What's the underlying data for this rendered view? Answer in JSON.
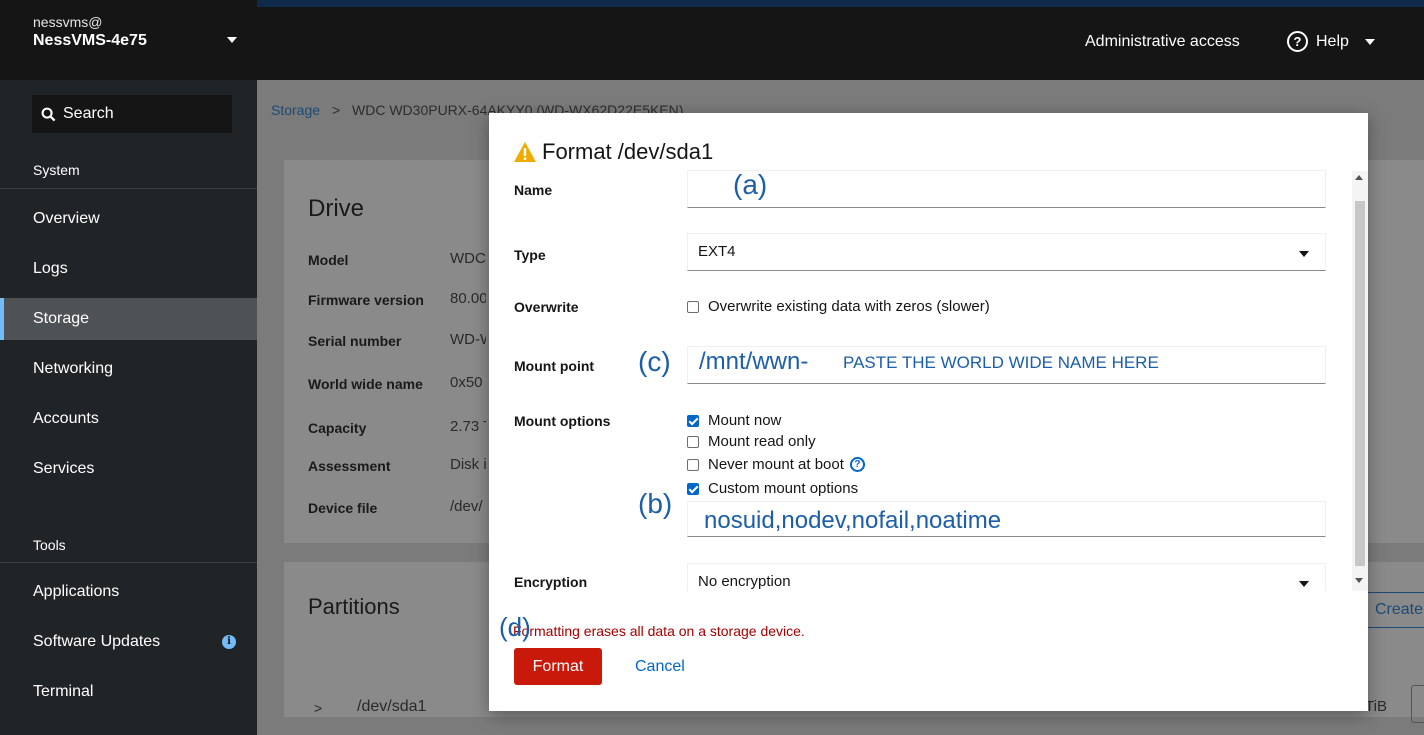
{
  "sidebar": {
    "user": "nessvms@",
    "host": "NessVMS-4e75",
    "search_label": "Search",
    "section_system": "System",
    "section_tools": "Tools",
    "items": [
      {
        "label": "Overview"
      },
      {
        "label": "Logs"
      },
      {
        "label": "Storage"
      },
      {
        "label": "Networking"
      },
      {
        "label": "Accounts"
      },
      {
        "label": "Services"
      }
    ],
    "tools": [
      {
        "label": "Applications"
      },
      {
        "label": "Software Updates"
      },
      {
        "label": "Terminal"
      }
    ],
    "info_badge": "i"
  },
  "topbar": {
    "admin": "Administrative access",
    "help": "Help",
    "help_icon": "?"
  },
  "breadcrumb": {
    "root": "Storage",
    "sep": ">",
    "current": "WDC WD30PURX-64AKYY0 (WD-WX62D22E5KEN)"
  },
  "drive": {
    "title": "Drive",
    "rows": [
      {
        "key": "Model",
        "value": "WDC"
      },
      {
        "key": "Firmware version",
        "value": "80.00"
      },
      {
        "key": "Serial number",
        "value": "WD-W"
      },
      {
        "key": "World wide name",
        "value": "0x50"
      },
      {
        "key": "Capacity",
        "value": "2.73 T"
      },
      {
        "key": "Assessment",
        "value": "Disk is"
      },
      {
        "key": "Device file",
        "value": "/dev/"
      }
    ]
  },
  "partitions": {
    "title": "Partitions",
    "create": "Create",
    "row_chevron": ">",
    "row_name": "/dev/sda1",
    "row_size": "TiB"
  },
  "modal": {
    "title": "Format /dev/sda1",
    "name_label": "Name",
    "name_value": "",
    "type_label": "Type",
    "type_value": "EXT4",
    "overwrite_label": "Overwrite",
    "overwrite_text": "Overwrite existing data with zeros (slower)",
    "mount_point_label": "Mount point",
    "mount_point_value": "/mnt/wwn-",
    "mount_point_hint": "PASTE THE WORLD WIDE NAME HERE",
    "mount_options_label": "Mount options",
    "opt_now": "Mount now",
    "opt_readonly": "Mount read only",
    "opt_never": "Never mount at boot",
    "opt_custom": "Custom mount options",
    "custom_value": "nosuid,nodev,nofail,noatime",
    "encryption_label": "Encryption",
    "encryption_value": "No encryption",
    "warning": "Formatting erases all data on a storage device.",
    "format_btn": "Format",
    "cancel_btn": "Cancel",
    "help_mark": "?"
  },
  "annotations": {
    "a": "(a)",
    "b": "(b)",
    "c": "(c)",
    "d": "(d)"
  },
  "checked": {
    "overwrite": false,
    "now": true,
    "readonly": false,
    "never": false,
    "custom": true
  }
}
